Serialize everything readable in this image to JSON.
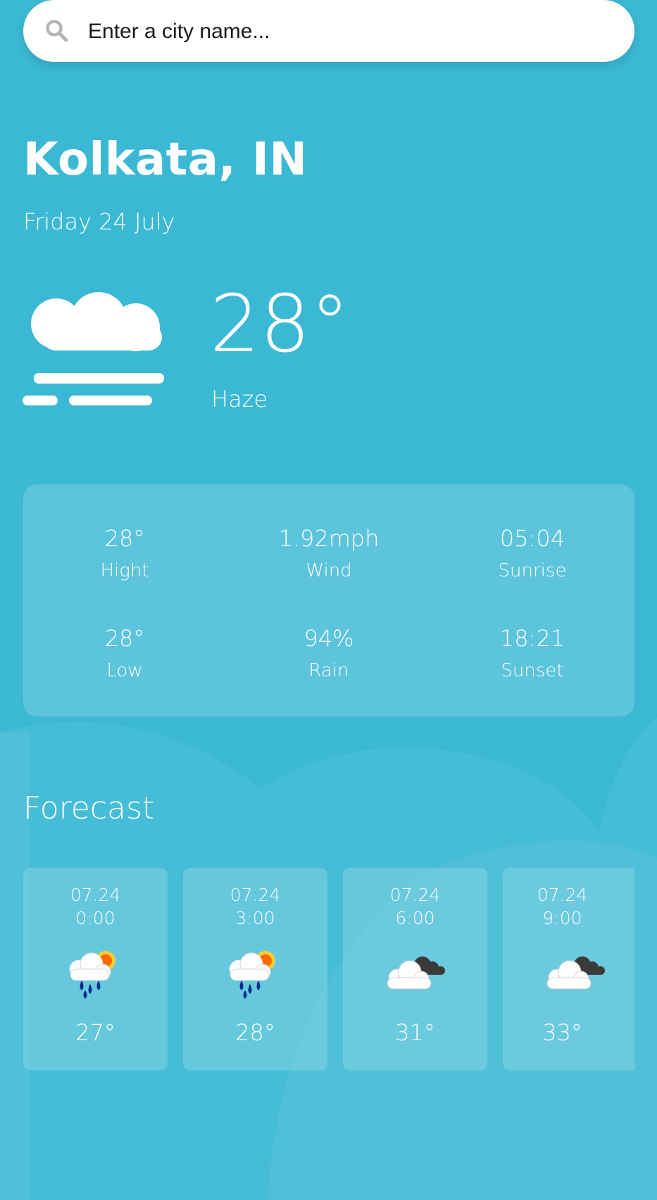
{
  "search": {
    "placeholder": "Enter a city name..."
  },
  "location": {
    "city": "Kolkata, IN",
    "date": "Friday 24 July"
  },
  "current": {
    "temperature": "28°",
    "condition": "Haze",
    "icon": "haze-icon"
  },
  "stats": [
    {
      "value": "28°",
      "label": "Hight"
    },
    {
      "value": "1.92mph",
      "label": "Wind"
    },
    {
      "value": "05:04",
      "label": "Sunrise"
    },
    {
      "value": "28°",
      "label": "Low"
    },
    {
      "value": "94%",
      "label": "Rain"
    },
    {
      "value": "18:21",
      "label": "Sunset"
    }
  ],
  "forecast": {
    "title": "Forecast",
    "items": [
      {
        "date": "07.24",
        "time": "0:00",
        "temp": "27°",
        "icon": "rain-sun-icon"
      },
      {
        "date": "07.24",
        "time": "3:00",
        "temp": "28°",
        "icon": "rain-sun-icon"
      },
      {
        "date": "07.24",
        "time": "6:00",
        "temp": "31°",
        "icon": "cloudy-icon"
      },
      {
        "date": "07.24",
        "time": "9:00",
        "temp": "33°",
        "icon": "cloudy-icon"
      }
    ]
  },
  "colors": {
    "background": "#3bb9d4",
    "panel": "rgba(255,255,255,0.17)",
    "text": "#ffffff"
  }
}
